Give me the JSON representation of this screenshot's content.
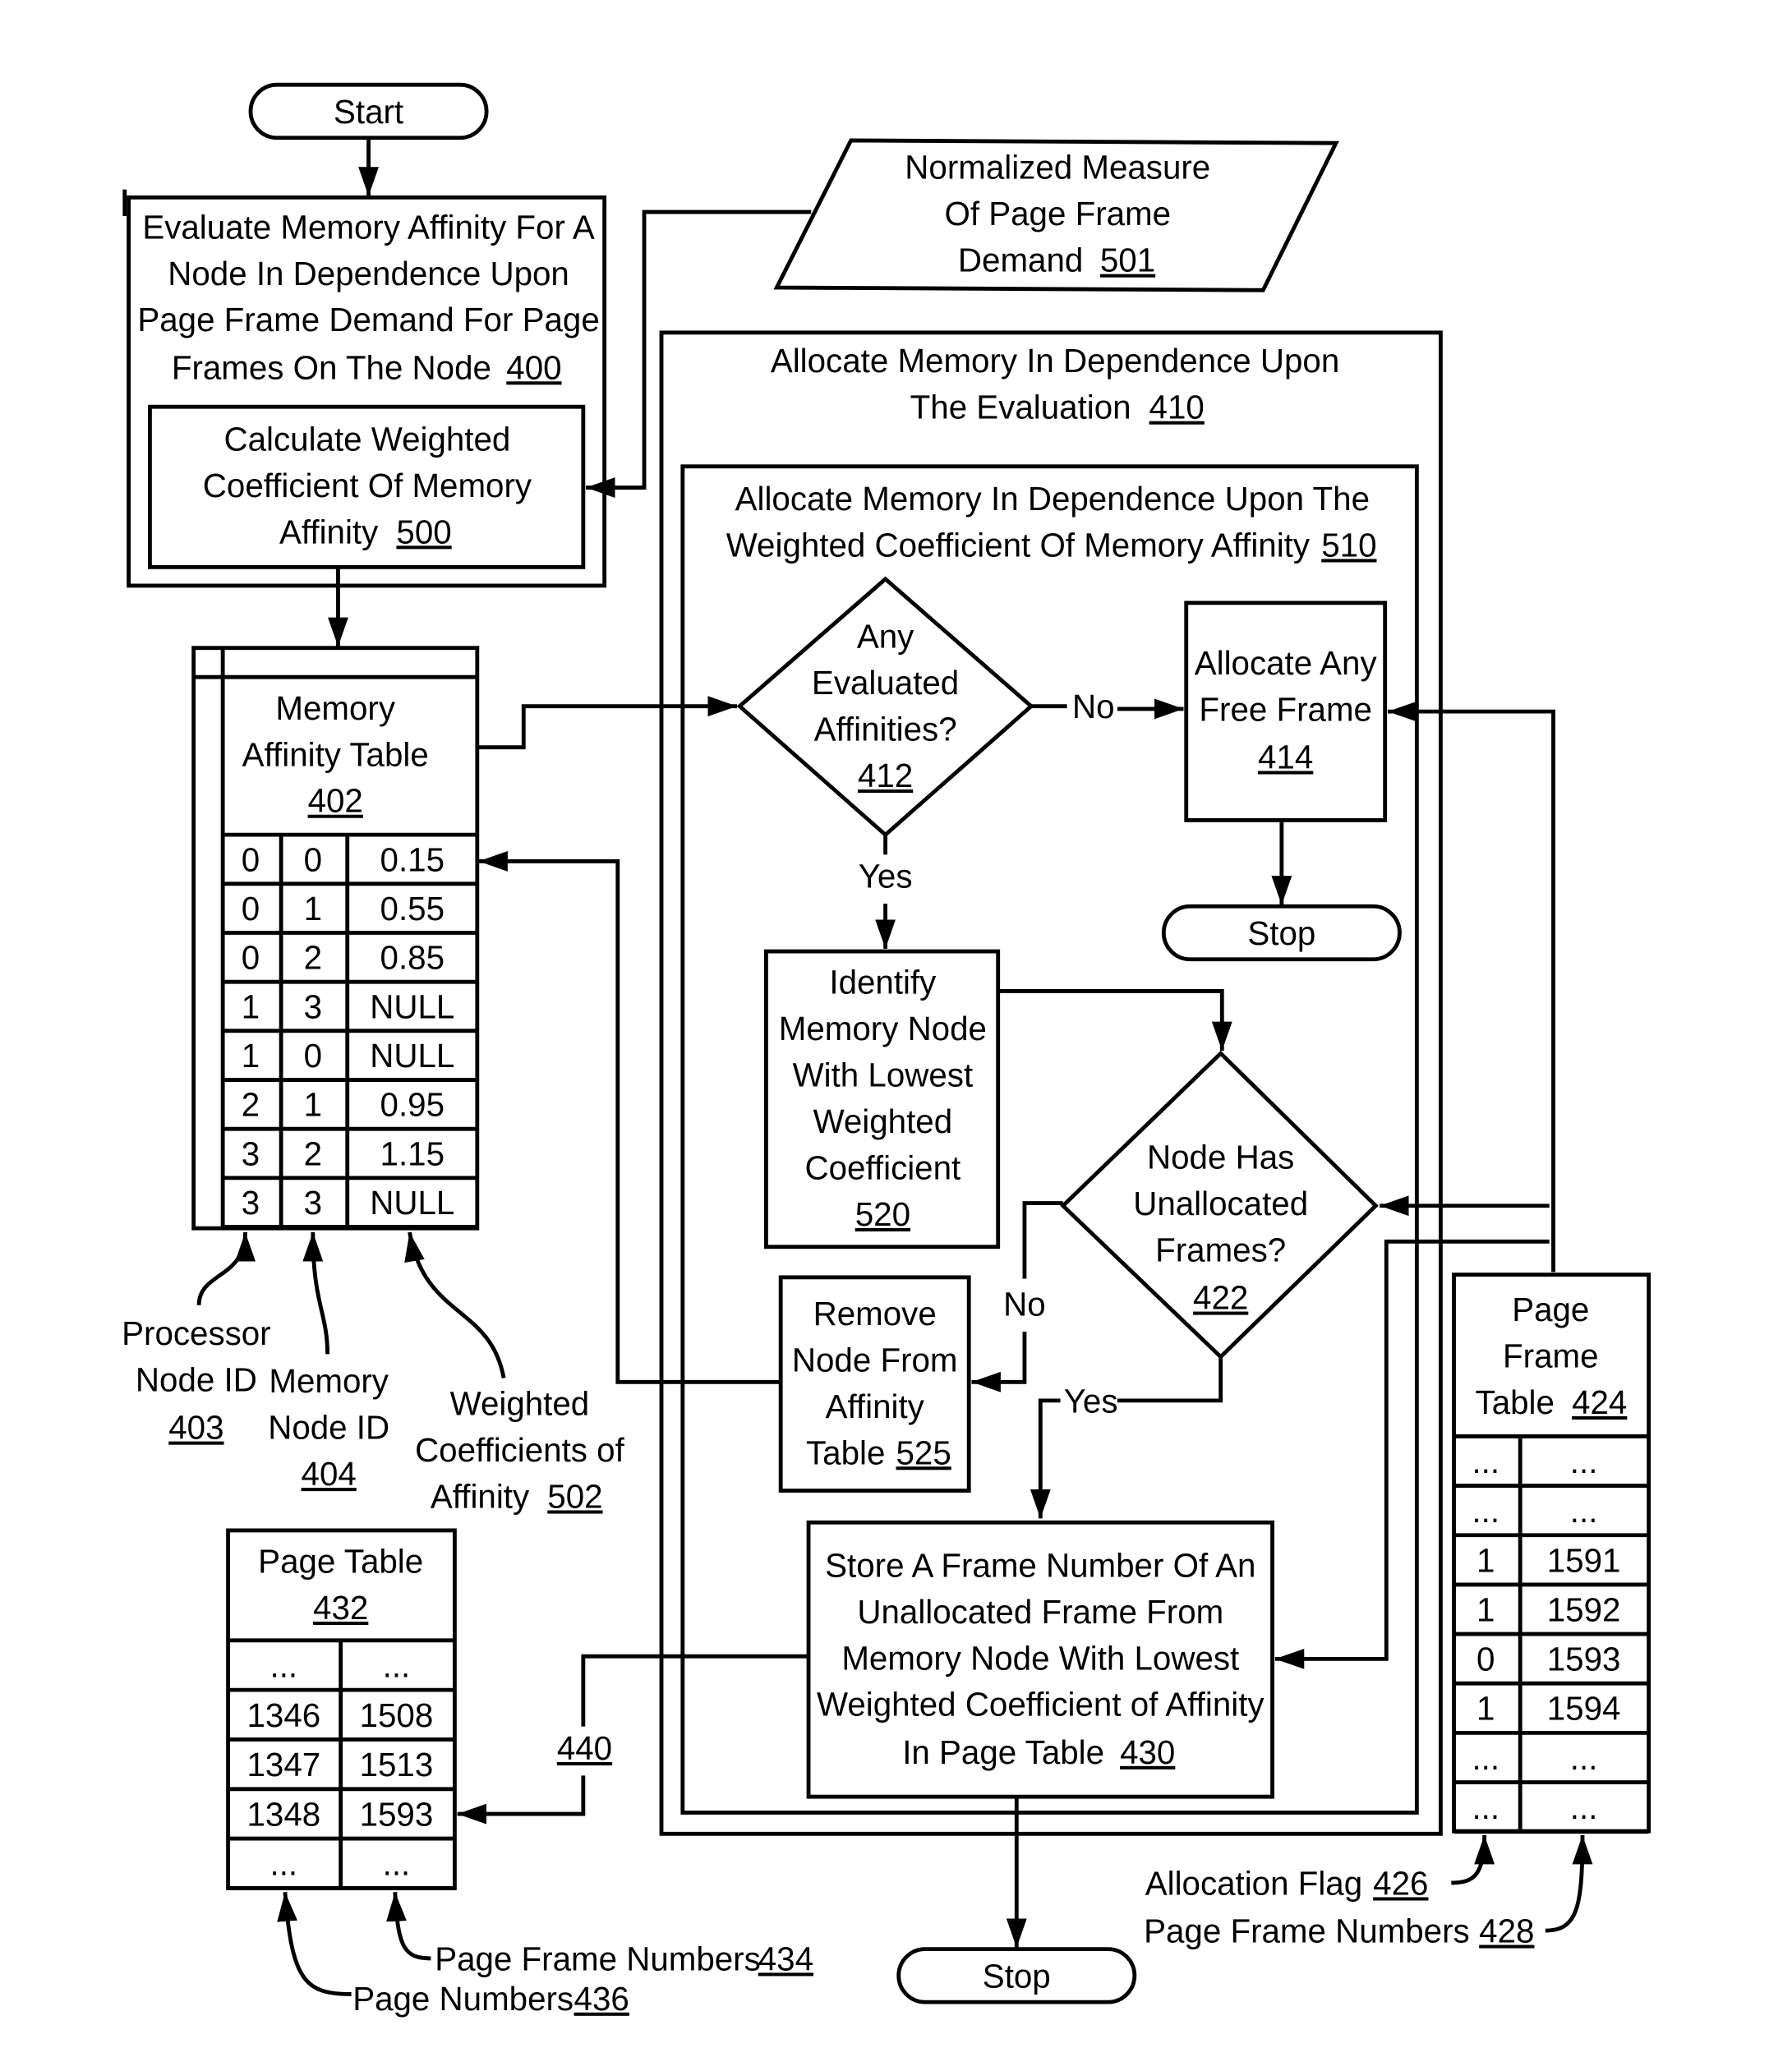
{
  "figure": {
    "start": "Start",
    "box_400": {
      "lines": [
        "Evaluate Memory Affinity For A",
        "Node In Dependence Upon",
        "Page Frame Demand For Page",
        "Frames On The Node"
      ],
      "ref": "400"
    },
    "box_500": {
      "lines": [
        "Calculate Weighted",
        "Coefficient Of Memory",
        "Affinity"
      ],
      "ref": "500"
    },
    "input_501": {
      "lines": [
        "Normalized Measure",
        "Of Page Frame",
        "Demand"
      ],
      "ref": "501"
    },
    "box_410": {
      "lines": [
        "Allocate Memory In Dependence Upon",
        "The Evaluation"
      ],
      "ref": "410"
    },
    "box_510": {
      "lines": [
        "Allocate Memory In Dependence Upon The",
        "Weighted Coefficient Of Memory Affinity"
      ],
      "ref": "510"
    },
    "decision_412": {
      "lines": [
        "Any",
        "Evaluated",
        "Affinities?"
      ],
      "ref": "412",
      "no_label": "No",
      "yes_label": "Yes"
    },
    "box_414": {
      "lines": [
        "Allocate Any",
        "Free Frame"
      ],
      "ref": "414"
    },
    "stop_1": "Stop",
    "box_520": {
      "lines": [
        "Identify",
        "Memory Node",
        "With Lowest",
        "Weighted",
        "Coefficient"
      ],
      "ref": "520"
    },
    "decision_422": {
      "lines": [
        "Node Has",
        "Unallocated",
        "Frames?"
      ],
      "ref": "422",
      "no_label": "No",
      "yes_label": "Yes"
    },
    "box_525": {
      "lines": [
        "Remove",
        "Node From",
        "Affinity",
        "Table"
      ],
      "ref": "525"
    },
    "box_430": {
      "lines": [
        "Store A Frame Number Of An",
        "Unallocated Frame From",
        "Memory Node With Lowest",
        "Weighted Coefficient of Affinity",
        "In Page Table"
      ],
      "ref": "430"
    },
    "stop_2": "Stop",
    "connector_440": "440"
  },
  "memory_affinity_table": {
    "title_lines": [
      "Memory",
      "Affinity Table"
    ],
    "ref": "402",
    "rows": [
      [
        "0",
        "0",
        "0.15"
      ],
      [
        "0",
        "1",
        "0.55"
      ],
      [
        "0",
        "2",
        "0.85"
      ],
      [
        "1",
        "3",
        "NULL"
      ],
      [
        "1",
        "0",
        "NULL"
      ],
      [
        "2",
        "1",
        "0.95"
      ],
      [
        "3",
        "2",
        "1.15"
      ],
      [
        "3",
        "3",
        "NULL"
      ]
    ],
    "callouts": {
      "processor_node_id": {
        "lines": [
          "Processor",
          "Node ID"
        ],
        "ref": "403"
      },
      "memory_node_id": {
        "lines": [
          "Memory",
          "Node ID"
        ],
        "ref": "404"
      },
      "weighted_coefficients": {
        "lines": [
          "Weighted",
          "Coefficients of",
          "Affinity"
        ],
        "ref": "502"
      }
    }
  },
  "page_table": {
    "title": "Page Table",
    "ref": "432",
    "rows": [
      [
        "...",
        "..."
      ],
      [
        "1346",
        "1508"
      ],
      [
        "1347",
        "1513"
      ],
      [
        "1348",
        "1593"
      ],
      [
        "...",
        "..."
      ]
    ],
    "callouts": {
      "page_frame_numbers": {
        "label": "Page Frame Numbers",
        "ref": "434"
      },
      "page_numbers": {
        "label": "Page Numbers",
        "ref": "436"
      }
    }
  },
  "page_frame_table": {
    "title_lines": [
      "Page",
      "Frame",
      "Table"
    ],
    "ref": "424",
    "rows": [
      [
        "...",
        "..."
      ],
      [
        "...",
        "..."
      ],
      [
        "1",
        "1591"
      ],
      [
        "1",
        "1592"
      ],
      [
        "0",
        "1593"
      ],
      [
        "1",
        "1594"
      ],
      [
        "...",
        "..."
      ],
      [
        "...",
        "..."
      ]
    ],
    "callouts": {
      "allocation_flag": {
        "label": "Allocation Flag",
        "ref": "426"
      },
      "page_frame_numbers": {
        "label": "Page Frame Numbers",
        "ref": "428"
      }
    }
  }
}
